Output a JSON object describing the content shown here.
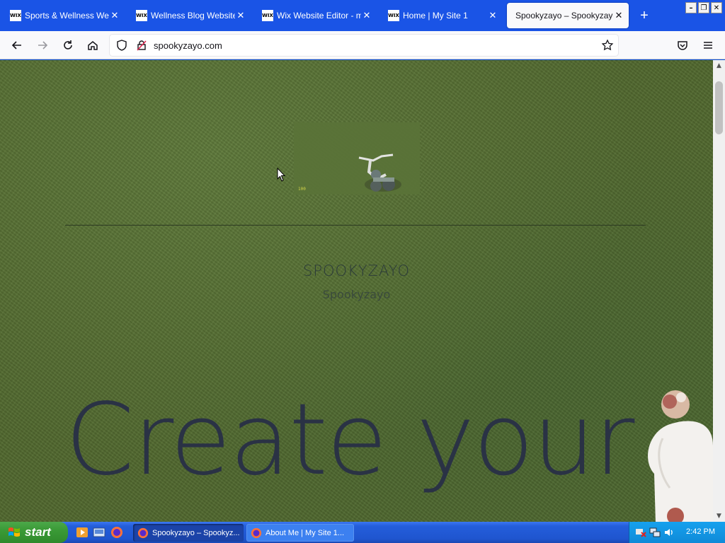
{
  "tabs": [
    {
      "favicon": "WIX",
      "title": "Sports & Wellness Website",
      "active": false
    },
    {
      "favicon": "WIX",
      "title": "Wellness Blog Website Te",
      "active": false
    },
    {
      "favicon": "WIX",
      "title": "Wix Website Editor - my-",
      "active": false
    },
    {
      "favicon": "WIX",
      "title": "Home | My Site 1",
      "active": false
    },
    {
      "favicon": "",
      "title": "Spookyzayo – Spookyzayo",
      "active": true
    }
  ],
  "new_tab_label": "+",
  "window_controls": {
    "minimize": "–",
    "restore": "❐",
    "close": "✕"
  },
  "address": {
    "url": "spookyzayo.com"
  },
  "page": {
    "media_hud": "100",
    "site_title": "SPOOKYZAYO",
    "site_subtitle": "Spookyzayo",
    "hero_text": "Create your"
  },
  "scrollbar": {
    "up": "▲",
    "down": "▼"
  },
  "taskbar": {
    "start_label": "start",
    "tasks": [
      {
        "title": "Spookyzayo – Spookyz...",
        "active": true
      },
      {
        "title": "About Me | My Site 1...",
        "active": false
      }
    ],
    "clock": "2:42 PM"
  },
  "colors": {
    "tabstrip": "#1a54e6",
    "toolbar": "#f9f9fb",
    "grass": "#52692f",
    "hero_text": "#2a3245",
    "taskbar": "#245edb",
    "start_green": "#3a9a36"
  }
}
